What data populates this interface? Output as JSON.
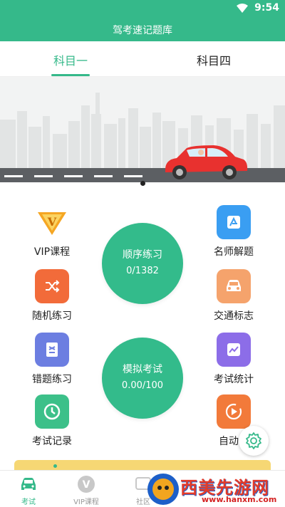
{
  "status": {
    "time": "9:54"
  },
  "header": {
    "title": "驾考速记题库"
  },
  "tabs": [
    {
      "label": "科目一",
      "active": true
    },
    {
      "label": "科目四",
      "active": false
    }
  ],
  "features_left": [
    {
      "label": "VIP课程",
      "icon": "vip-crown-icon",
      "color": "#f5a623"
    },
    {
      "label": "随机练习",
      "icon": "shuffle-icon",
      "color": "#f26b3a"
    },
    {
      "label": "错题练习",
      "icon": "document-icon",
      "color": "#6c7ee1"
    },
    {
      "label": "考试记录",
      "icon": "clock-icon",
      "color": "#3cc089"
    }
  ],
  "features_right": [
    {
      "label": "名师解题",
      "icon": "teacher-icon",
      "color": "#3a9ef2"
    },
    {
      "label": "交通标志",
      "icon": "car-icon",
      "color": "#f5a36c"
    },
    {
      "label": "考试统计",
      "icon": "chart-icon",
      "color": "#8c6de8"
    },
    {
      "label": "自动播",
      "icon": "autoplay-icon",
      "color": "#f27a3a"
    }
  ],
  "center_buttons": [
    {
      "title": "顺序练习",
      "count": "0/1382"
    },
    {
      "title": "模拟考试",
      "count": "0.00/100"
    }
  ],
  "bottom_nav": [
    {
      "label": "考试",
      "active": true
    },
    {
      "label": "VIP课程",
      "active": false
    },
    {
      "label": "社区",
      "active": false
    }
  ],
  "watermark": {
    "text": "西美先游网",
    "url": "www.hanxm.com"
  },
  "colors": {
    "primary": "#35b98a",
    "banner_bg": "#f2f3f3",
    "car": "#e8312f"
  }
}
